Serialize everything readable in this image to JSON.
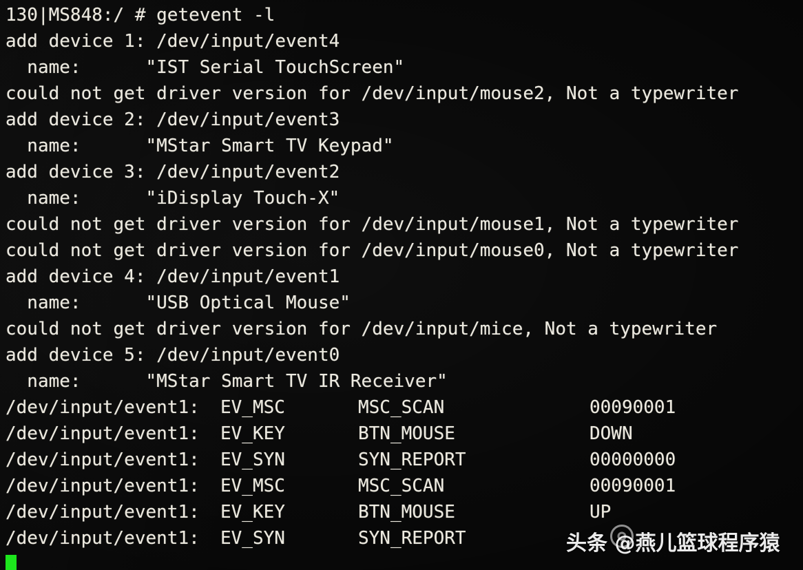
{
  "terminal": {
    "prompt_line": "130|MS848:/ # getevent -l",
    "colors": {
      "background": "#060606",
      "foreground": "#ece9df",
      "cursor": "#19e619"
    },
    "lines": [
      "130|MS848:/ # getevent -l",
      "add device 1: /dev/input/event4",
      "  name:      \"IST Serial TouchScreen\"",
      "could not get driver version for /dev/input/mouse2, Not a typewriter",
      "add device 2: /dev/input/event3",
      "  name:      \"MStar Smart TV Keypad\"",
      "add device 3: /dev/input/event2",
      "  name:      \"iDisplay Touch-X\"",
      "could not get driver version for /dev/input/mouse1, Not a typewriter",
      "could not get driver version for /dev/input/mouse0, Not a typewriter",
      "add device 4: /dev/input/event1",
      "  name:      \"USB Optical Mouse\"",
      "could not get driver version for /dev/input/mice, Not a typewriter",
      "add device 5: /dev/input/event0",
      "  name:      \"MStar Smart TV IR Receiver\""
    ],
    "events": [
      {
        "device": "/dev/input/event1:",
        "type": "EV_MSC",
        "code": "MSC_SCAN",
        "value": "00090001"
      },
      {
        "device": "/dev/input/event1:",
        "type": "EV_KEY",
        "code": "BTN_MOUSE",
        "value": "DOWN"
      },
      {
        "device": "/dev/input/event1:",
        "type": "EV_SYN",
        "code": "SYN_REPORT",
        "value": "00000000"
      },
      {
        "device": "/dev/input/event1:",
        "type": "EV_MSC",
        "code": "MSC_SCAN",
        "value": "00090001"
      },
      {
        "device": "/dev/input/event1:",
        "type": "EV_KEY",
        "code": "BTN_MOUSE",
        "value": "UP"
      },
      {
        "device": "/dev/input/event1:",
        "type": "EV_SYN",
        "code": "SYN_REPORT",
        "value": ""
      }
    ]
  },
  "watermark": {
    "text": "头条 @燕儿篮球程序猿"
  }
}
